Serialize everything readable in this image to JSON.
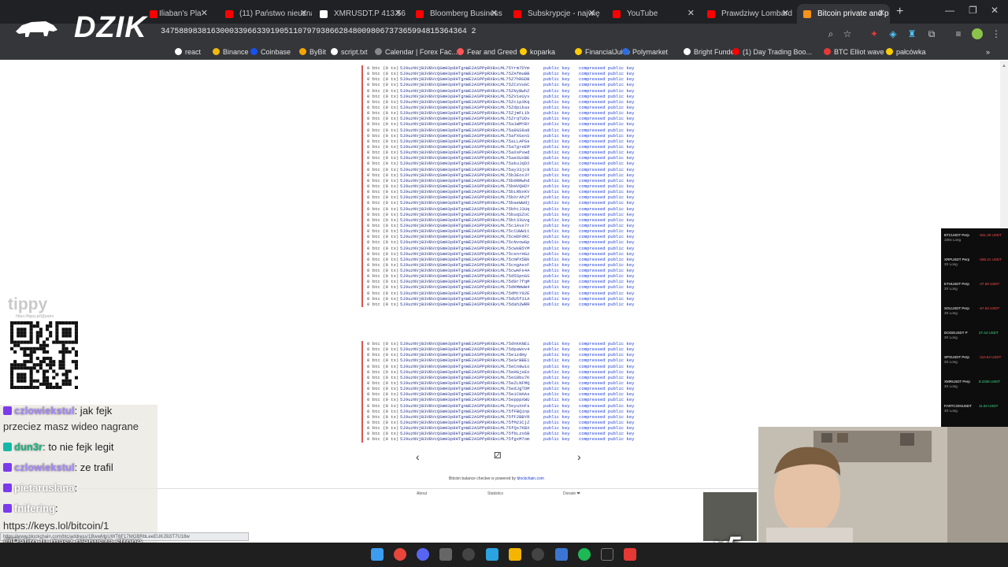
{
  "browser": {
    "tabs": [
      {
        "label": "Iliaban's Pla",
        "color": "#ff0000"
      },
      {
        "label": "(11) Państwo nieuznan",
        "color": "#ff0000"
      },
      {
        "label": "XMRUSDT.P 413.56 ▲",
        "color": "#ffffff"
      },
      {
        "label": "Bloomberg Business",
        "color": "#ff0000"
      },
      {
        "label": "Subskrypcje - najwięk",
        "color": "#ff0000"
      },
      {
        "label": "YouTube",
        "color": "#ff0000"
      },
      {
        "label": "Prawdziwy Lombard",
        "color": "#ff0000"
      },
      {
        "label": "Bitcoin private and p",
        "color": "#f7931a"
      }
    ],
    "url": "3475889838163000339663391905110797938662848009806737365994815364364 2",
    "bookmarks": [
      {
        "label": "react",
        "color": "#ffffff"
      },
      {
        "label": "Binance",
        "color": "#f0b90b"
      },
      {
        "label": "Coinbase",
        "color": "#1652f0"
      },
      {
        "label": "ByBit",
        "color": "#f7a600"
      },
      {
        "label": "script.txt",
        "color": "#ffffff"
      },
      {
        "label": "Calendar | Forex Fac...",
        "color": "#888888"
      },
      {
        "label": "Fear and Greed",
        "color": "#ff5555"
      },
      {
        "label": "koparka",
        "color": "#ffcc00"
      },
      {
        "label": "FinancialJuice",
        "color": "#ffcc00"
      },
      {
        "label": "Polymarket",
        "color": "#2d6cdf"
      },
      {
        "label": "Bright Funded",
        "color": "#ffffff"
      },
      {
        "label": "(1) Day Trading Boo...",
        "color": "#ff0000"
      },
      {
        "label": "BTC Elliot wave",
        "color": "#e53935"
      },
      {
        "label": "pałcówka",
        "color": "#ffcc00"
      }
    ]
  },
  "logo": {
    "text": "DZIK"
  },
  "keys": {
    "btc_label": "0 btc (0 tx)",
    "address_prefix": "5J9uzNVjB3VBVcQGmH3p8HTgnWE2ASPPpRXBxLML7",
    "public_label": "public key",
    "compressed_label": "compressed public key",
    "list1_suffixes": [
      "5Yrm7DYm",
      "5ZAfmuBB",
      "5Z7hRGDB",
      "5ZCsVuGC",
      "5ZNyBwhZ",
      "5ZV1eUyv",
      "5Zcip3Kq",
      "5Zdpikas",
      "5ZjmFL1b",
      "5ZrqTUDv",
      "5a1WMYBY",
      "5a8GS8a8",
      "5afXGsnS",
      "5aLLAPGs",
      "5aTgreEM",
      "5aXsPvwd",
      "5aeSUxBE",
      "5akuJqD2",
      "5ay33jc9",
      "5b3Eox3Y",
      "5b9RRwhd",
      "5bHVQHDY",
      "5bLRbxKV",
      "5bXrAh2f",
      "5baeWWdj",
      "5bhtJ3Uq",
      "5buqSZoC",
      "5bt33Uvg",
      "5c1Avs7r",
      "5cCUWW1t",
      "5cHDFdKC",
      "5cNvowGp",
      "5cWsB5YM",
      "5cenrHGz",
      "5cmPX5Bk",
      "5cngAsxF",
      "5cwAFs4A",
      "5d5SpnGS",
      "5d9r7fqM",
      "5dKMmWW4",
      "5dMtY92E",
      "5dU5f31A",
      "5dah2WRR"
    ],
    "list2_suffixes": [
      "5dnkKNEi",
      "5dpaWvv4",
      "5e1zdmy",
      "5eGrBBEi",
      "5eCn8w1o",
      "5eHGjsEo",
      "5eS9bu7K",
      "5eZLNFMQ",
      "5edJgTDM",
      "5eiCHAAs",
      "5epppXWU",
      "5eyuXnFs",
      "5fFBQ1np",
      "5fF2BBYR",
      "5fM23CjZ",
      "5fQs7KBX",
      "5fbLzx6B",
      "5fgxM7om"
    ]
  },
  "pager": {
    "prev": "‹",
    "next": "›"
  },
  "footer": {
    "powered_prefix": "Bitcoin balance checker is powered by",
    "powered_link": "blockchain.com",
    "about": "About",
    "statistics": "Statistics",
    "donate": "Donate ❤"
  },
  "overlay": {
    "tippy_brand": "tippy",
    "tippy_sub": "https://tippy.pl/@patro",
    "chat": [
      {
        "user": "czlowiekstul",
        "text": ": jak fejk"
      },
      {
        "user": "",
        "text": "przeciez masz wideo nagrane"
      },
      {
        "user": "dun3r",
        "text": ": to nie fejk legit"
      },
      {
        "user": "czlowiekstul",
        "text": ": ze trafil"
      },
      {
        "user": "pietaruslana",
        "text": ":"
      },
      {
        "user": "fnifering",
        "text": ":"
      },
      {
        "user": "",
        "text": "https://keys.lol/bitcoin/1"
      }
    ],
    "bottom_message": "@Patiro tu masz pierwsza strone ale cala zabrana juz",
    "status_url": "https://www.blockchain.com/btc/address/1BwwMpUWT6F17MGBRbLeeEUKJ92iT7U18w",
    "gift": "x5"
  },
  "trades": [
    {
      "sym": "BTCUSDT Perp",
      "lev": "100x Long",
      "pnl": "-541.29 USDT"
    },
    {
      "sym": "XRPUSDT Perp",
      "lev": "3X Long",
      "pnl": "-285.21 USDT"
    },
    {
      "sym": "ETHUSDT Perp",
      "lev": "3X Long",
      "pnl": "-47.59 USDT"
    },
    {
      "sym": "SOLUSDT Perp",
      "lev": "3X Long",
      "pnl": "-67.63 USDT"
    },
    {
      "sym": "DOGEUSDT P",
      "lev": "3X Long",
      "pnl": "27.44 USDT"
    },
    {
      "sym": "SPXUSDT Perp",
      "lev": "3X Long",
      "pnl": "-110.64 USDT"
    },
    {
      "sym": "XMRUSDT Perp",
      "lev": "3X Long",
      "pnl": "8.2336 USDT"
    },
    {
      "sym": "FARTCOINUSDT",
      "lev": "3X Long",
      "pnl": "11.63 USDT"
    }
  ]
}
